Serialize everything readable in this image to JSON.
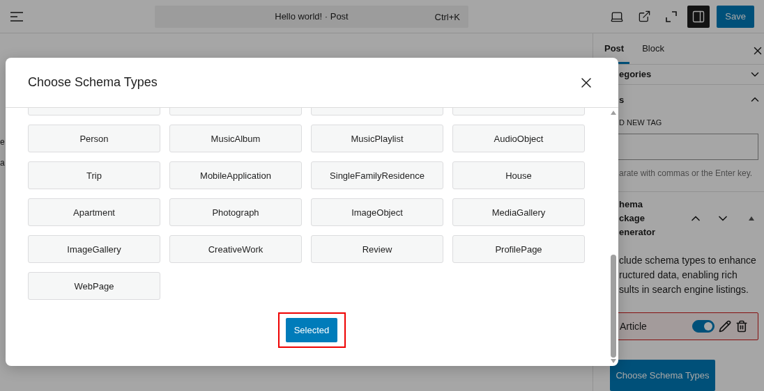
{
  "top_bar": {
    "title": "Hello world! · Post",
    "shortcut": "Ctrl+K",
    "sidebar_toggle_on": true,
    "save_label": "Save"
  },
  "editor_fragments": [
    "e",
    "a"
  ],
  "sidebar": {
    "tabs": [
      {
        "label": "Post",
        "selected": true
      },
      {
        "label": "Block",
        "selected": false
      }
    ],
    "categories": {
      "label": "egories",
      "expanded": false
    },
    "tags": {
      "label": "s",
      "expanded": true,
      "add_label": "D NEW TAG",
      "help": "arate with commas or the Enter key."
    },
    "schema_panel": {
      "title_lines": [
        "hema",
        "ckage",
        "enerator"
      ],
      "description_lines": [
        "clude schema types to enhance",
        "ructured data, enabling rich",
        "sults in search engine listings."
      ],
      "items": [
        {
          "label": "Article",
          "on": true
        }
      ],
      "choose_button": "Choose Schema Types"
    }
  },
  "modal": {
    "title": "Choose Schema Types",
    "types": [
      "Person",
      "MusicAlbum",
      "MusicPlaylist",
      "AudioObject",
      "Trip",
      "MobileApplication",
      "SingleFamilyResidence",
      "House",
      "Apartment",
      "Photograph",
      "ImageObject",
      "MediaGallery",
      "ImageGallery",
      "CreativeWork",
      "Review",
      "ProfilePage",
      "WebPage"
    ],
    "selected_button": "Selected"
  }
}
